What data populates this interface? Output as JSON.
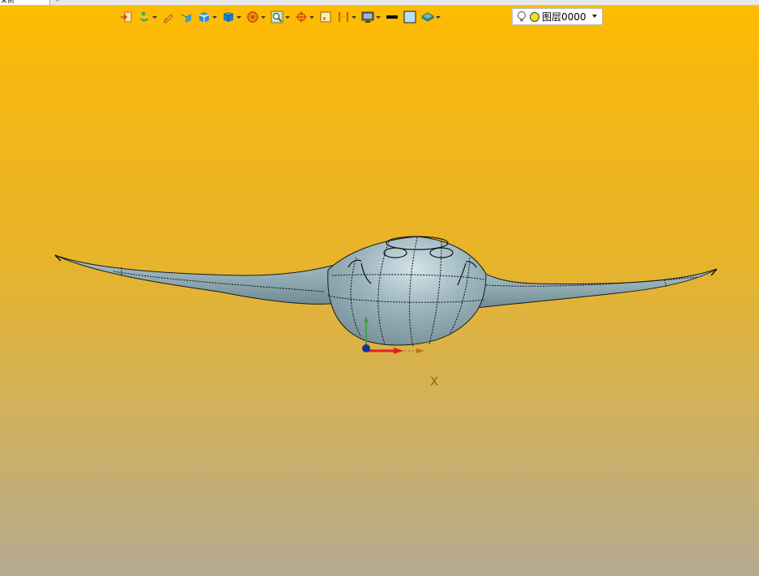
{
  "tab": {
    "title": "未例",
    "close": "×"
  },
  "toolbar": {
    "items": [
      {
        "icon": "import-icon",
        "dropdown": false
      },
      {
        "icon": "layers-stack-icon",
        "dropdown": true
      },
      {
        "icon": "pencil-icon",
        "dropdown": false
      },
      {
        "icon": "solid-box-icon",
        "dropdown": false
      },
      {
        "icon": "cube-view-icon",
        "dropdown": true
      },
      {
        "icon": "cube-render-icon",
        "dropdown": true
      },
      {
        "icon": "wheel-icon",
        "dropdown": true
      },
      {
        "icon": "zoom-fit-icon",
        "dropdown": true
      },
      {
        "icon": "snap-point-icon",
        "dropdown": true
      },
      {
        "icon": "frame-icon",
        "dropdown": false
      },
      {
        "icon": "dimension-icon",
        "dropdown": true
      },
      {
        "icon": "display-monitor-icon",
        "dropdown": true
      },
      {
        "icon": "line-weight-icon",
        "dropdown": false
      },
      {
        "icon": "color-square-icon",
        "dropdown": false
      },
      {
        "icon": "layer-style-icon",
        "dropdown": true
      }
    ],
    "layer_value": "图层0000"
  },
  "viewport": {
    "axis_x_label": "X",
    "background_top": "#ffbc00",
    "background_bottom": "#b4aa90",
    "model_color": "#8ea8b0"
  }
}
